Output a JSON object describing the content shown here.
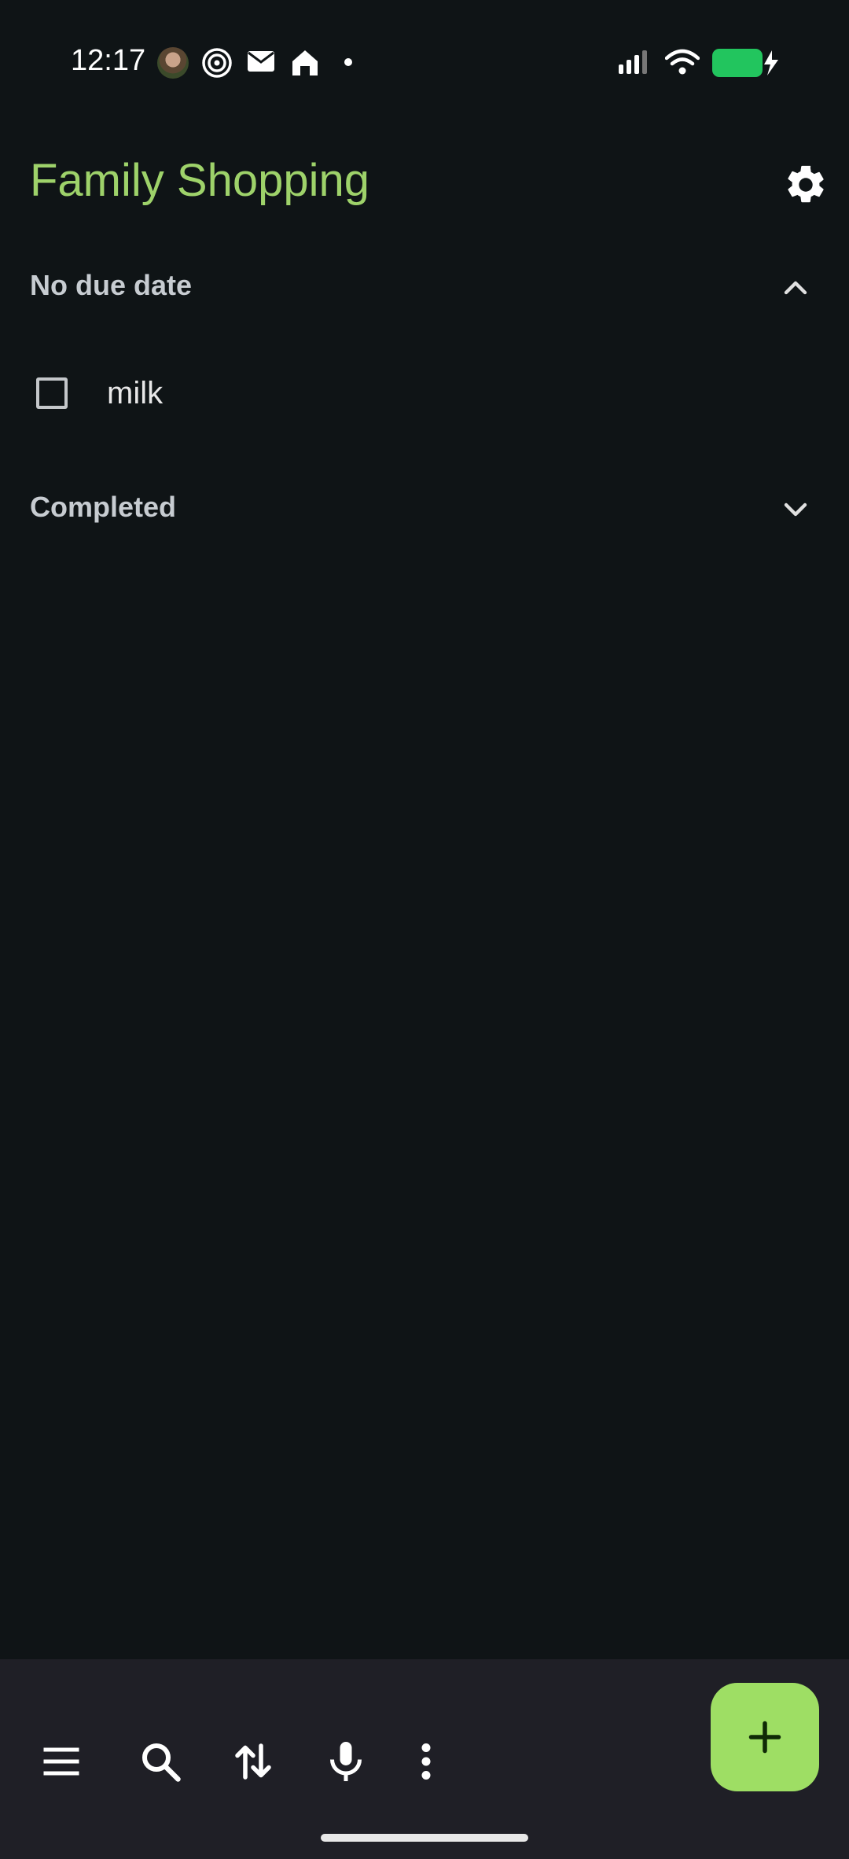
{
  "status_bar": {
    "time": "12:17",
    "icons": [
      "avatar-icon",
      "at-sign-icon",
      "mail-icon",
      "home-app-icon",
      "dot-icon",
      "signal-icon",
      "wifi-icon",
      "battery-charging-icon"
    ],
    "battery_color": "#22c55e"
  },
  "header": {
    "title": "Family Shopping",
    "title_color": "#9ed26a",
    "settings_icon": "gear-icon"
  },
  "sections": [
    {
      "label": "No due date",
      "expanded": true,
      "items": [
        {
          "label": "milk",
          "checked": false
        }
      ]
    },
    {
      "label": "Completed",
      "expanded": false,
      "items": []
    }
  ],
  "bottom_bar": {
    "icons": [
      "menu-icon",
      "search-icon",
      "sort-icon",
      "mic-icon",
      "more-vert-icon"
    ],
    "fab_icon": "plus-icon",
    "fab_color": "#9ede64"
  }
}
